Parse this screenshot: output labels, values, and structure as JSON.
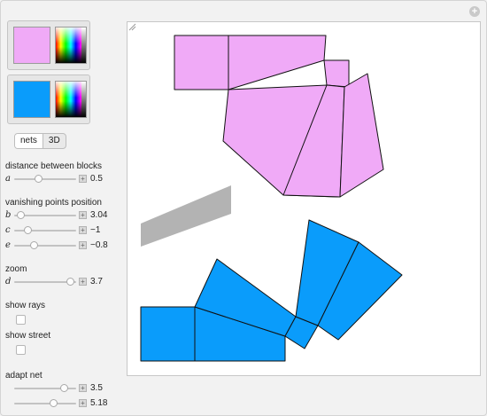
{
  "colors": {
    "block1": "#f0aaf7",
    "block2": "#0a9cfb",
    "street": "#b3b3b3",
    "panel_bg": "#f2f2f2"
  },
  "icons": {
    "corner": "plus-circle-icon",
    "resize": "resize-grip-icon",
    "stepper": "plus-icon"
  },
  "view": {
    "options": [
      "nets",
      "3D"
    ],
    "selected": "nets"
  },
  "controls": {
    "distance_label": "distance between blocks",
    "a": {
      "var": "a",
      "value": "0.5",
      "fraction": 0.38
    },
    "vanishing_label": "vanishing points position",
    "b": {
      "var": "b",
      "value": "3.04",
      "fraction": 0.05
    },
    "c": {
      "var": "c",
      "value": "−1",
      "fraction": 0.18
    },
    "e": {
      "var": "e",
      "value": "−0.8",
      "fraction": 0.3
    },
    "zoom_label": "zoom",
    "d": {
      "var": "d",
      "value": "3.7",
      "fraction": 0.96
    },
    "show_rays_label": "show rays",
    "show_rays": false,
    "show_street_label": "show street",
    "show_street": false,
    "adapt_label": "adapt net",
    "adapt1": {
      "value": "3.5",
      "fraction": 0.85
    },
    "adapt2": {
      "value": "5.18",
      "fraction": 0.65
    }
  }
}
